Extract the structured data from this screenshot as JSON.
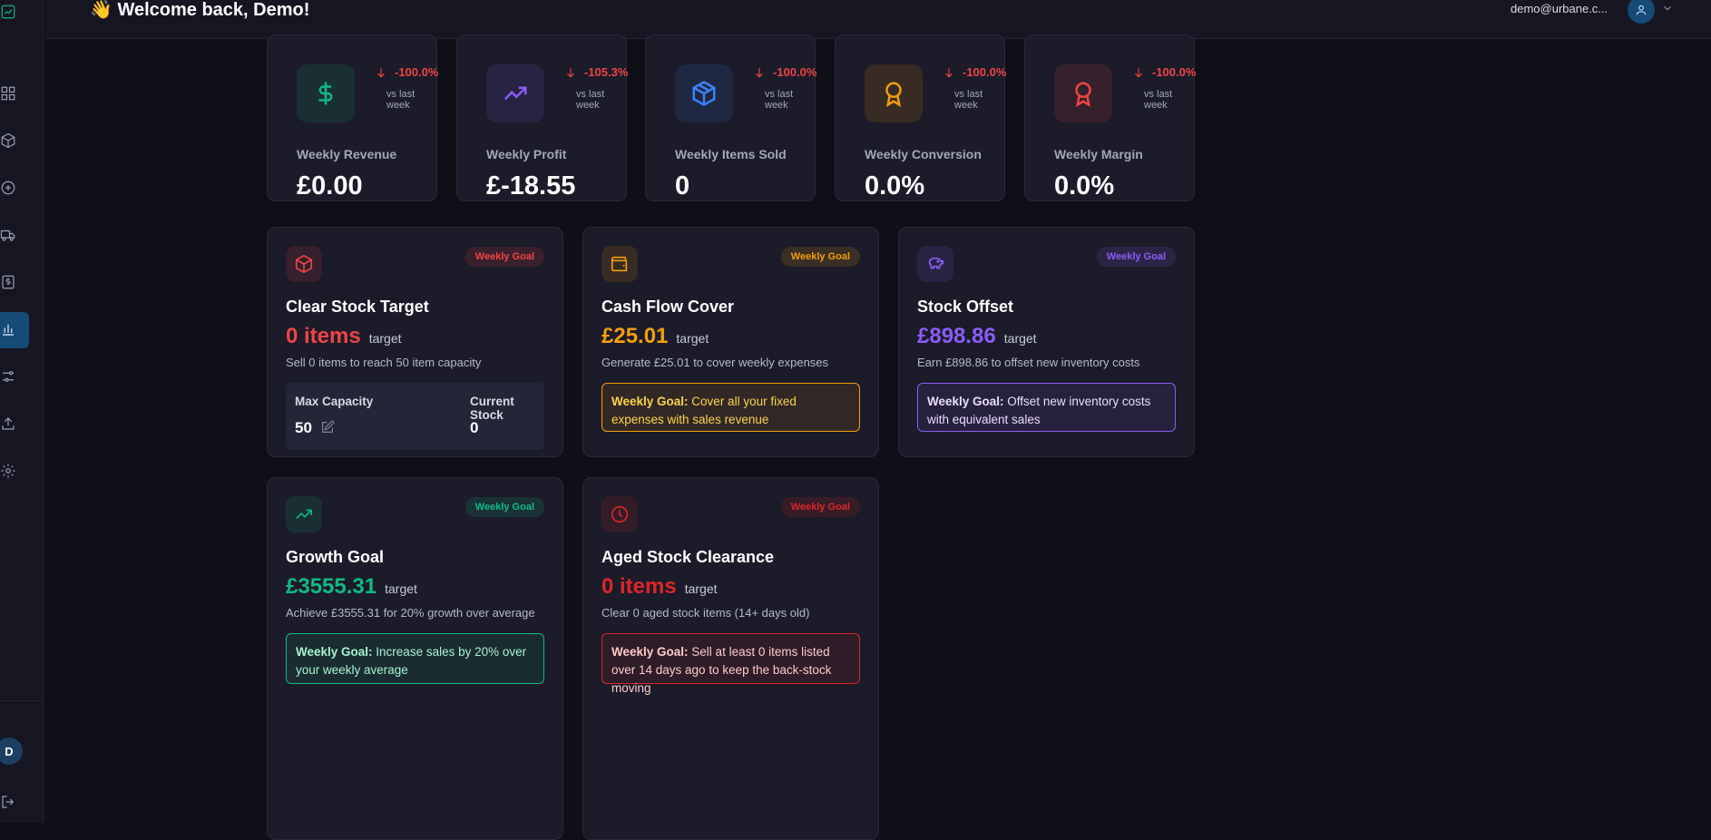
{
  "header": {
    "welcome": "👋 Welcome back, Demo!",
    "user_email": "demo@urbane.c..."
  },
  "sidebar": {
    "avatar_initial": "D",
    "items": [
      {
        "name": "dashboard-icon"
      },
      {
        "name": "box-icon"
      },
      {
        "name": "add-circle-icon"
      },
      {
        "name": "truck-icon"
      },
      {
        "name": "dollar-receipt-icon"
      },
      {
        "name": "bar-chart-icon",
        "active": true
      },
      {
        "name": "sliders-icon"
      },
      {
        "name": "upload-icon"
      },
      {
        "name": "gear-icon"
      }
    ],
    "logout_icon": "logout-icon"
  },
  "stats": [
    {
      "label": "Weekly Revenue",
      "value": "£0.00",
      "change": "-100.0%",
      "vs": "vs last week",
      "icon": "dollar-icon",
      "color": "#10b981"
    },
    {
      "label": "Weekly Profit",
      "value": "£-18.55",
      "change": "-105.3%",
      "vs": "vs last week",
      "icon": "trending-up-icon",
      "color": "#8b5cf6"
    },
    {
      "label": "Weekly Items Sold",
      "value": "0",
      "change": "-100.0%",
      "vs": "vs last week",
      "icon": "package-icon",
      "color": "#3b82f6"
    },
    {
      "label": "Weekly Conversion",
      "value": "0.0%",
      "change": "-100.0%",
      "vs": "vs last week",
      "icon": "award-icon",
      "color": "#f59e0b"
    },
    {
      "label": "Weekly Margin",
      "value": "0.0%",
      "change": "-100.0%",
      "vs": "vs last week",
      "icon": "award-icon",
      "color": "#ef4444"
    }
  ],
  "goals": [
    {
      "badge": "Weekly Goal",
      "title": "Clear Stock Target",
      "target_value": "0 items",
      "target_suffix": "target",
      "desc": "Sell 0 items to reach 50 item capacity",
      "color": "#ef4444",
      "icon": "box-icon",
      "capacity": {
        "max_label": "Max Capacity",
        "max_value": "50",
        "current_label": "Current Stock",
        "current_value": "0"
      }
    },
    {
      "badge": "Weekly Goal",
      "title": "Cash Flow Cover",
      "target_value": "£25.01",
      "target_suffix": "target",
      "desc": "Generate £25.01 to cover weekly expenses",
      "color": "#f59e0b",
      "icon": "wallet-icon",
      "note_label": "Weekly Goal:",
      "note_text": " Cover all your fixed expenses with sales revenue"
    },
    {
      "badge": "Weekly Goal",
      "title": "Stock Offset",
      "target_value": "£898.86",
      "target_suffix": "target",
      "desc": "Earn £898.86 to offset new inventory costs",
      "color": "#8b5cf6",
      "icon": "piggy-bank-icon",
      "note_label": "Weekly Goal:",
      "note_text": " Offset new inventory costs with equivalent sales"
    },
    {
      "badge": "Weekly Goal",
      "title": "Growth Goal",
      "target_value": "£3555.31",
      "target_suffix": "target",
      "desc": "Achieve £3555.31 for 20% growth over average",
      "color": "#10b981",
      "icon": "trending-up-icon",
      "note_label": "Weekly Goal:",
      "note_text": " Increase sales by 20% over your weekly average"
    },
    {
      "badge": "Weekly Goal",
      "title": "Aged Stock Clearance",
      "target_value": "0 items",
      "target_suffix": "target",
      "desc": "Clear 0 aged stock items (14+ days old)",
      "color": "#dc2626",
      "icon": "clock-icon",
      "note_label": "Weekly Goal:",
      "note_text": " Sell at least 0 items listed over 14 days ago to keep the back-stock moving"
    }
  ]
}
